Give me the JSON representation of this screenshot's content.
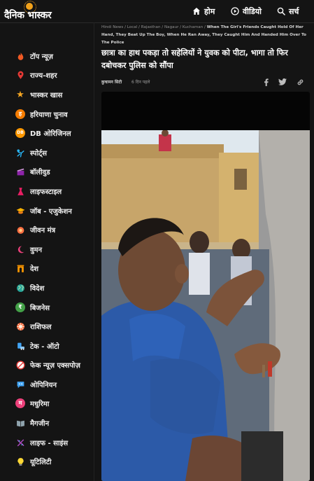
{
  "header": {
    "logo_text": "दैनिक भास्कर",
    "nav": [
      {
        "label": "होम",
        "icon": "home-icon"
      },
      {
        "label": "वीडियो",
        "icon": "play-circle-icon"
      },
      {
        "label": "सर्च",
        "icon": "search-icon"
      }
    ]
  },
  "sidebar": {
    "items": [
      {
        "label": "टॉप न्यूज़",
        "icon": "flame-icon",
        "color": "#f15a24"
      },
      {
        "label": "राज्य-शहर",
        "icon": "location-pin-icon",
        "color": "#e53935"
      },
      {
        "label": "भास्कर खास",
        "icon": "star-icon",
        "color": "#f5a623"
      },
      {
        "label": "हरियाणा चुनाव",
        "icon": "haryana-election-icon",
        "color": "#f57c00"
      },
      {
        "label": "DB ओरिजिनल",
        "icon": "db-original-icon",
        "color": "#ff9800"
      },
      {
        "label": "स्पोर्ट्स",
        "icon": "sports-icon",
        "color": "#29b6f6"
      },
      {
        "label": "बॉलीवुड",
        "icon": "clapperboard-icon",
        "color": "#8e24aa"
      },
      {
        "label": "लाइफस्टाइल",
        "icon": "lifestyle-icon",
        "color": "#e91e63"
      },
      {
        "label": "जॉब - एजुकेशन",
        "icon": "graduation-cap-icon",
        "color": "#ffb300"
      },
      {
        "label": "जीवन मंत्र",
        "icon": "jeevan-mantra-icon",
        "color": "#ff7043"
      },
      {
        "label": "वुमन",
        "icon": "woman-icon",
        "color": "#ec407a"
      },
      {
        "label": "देश",
        "icon": "india-gate-icon",
        "color": "#ff9800"
      },
      {
        "label": "विदेश",
        "icon": "globe-icon",
        "color": "#26a69a"
      },
      {
        "label": "बिजनेस",
        "icon": "rupee-icon",
        "color": "#43a047"
      },
      {
        "label": "राशिफल",
        "icon": "zodiac-wheel-icon",
        "color": "#ff7043"
      },
      {
        "label": "टेक - ऑटो",
        "icon": "tech-auto-icon",
        "color": "#42a5f5"
      },
      {
        "label": "फेक न्यूज़ एक्सपोज़",
        "icon": "fake-news-icon",
        "color": "#e53935"
      },
      {
        "label": "ओपिनियन",
        "icon": "speech-bubble-icon",
        "color": "#42a5f5"
      },
      {
        "label": "मधुरिमा",
        "icon": "madhurima-icon",
        "color": "#ec407a"
      },
      {
        "label": "मैगजीन",
        "icon": "magazine-icon",
        "color": "#90a4ae"
      },
      {
        "label": "लाइफ - साइंस",
        "icon": "dna-icon",
        "color": "#ab47bc"
      },
      {
        "label": "यूटिलिटी",
        "icon": "bulb-icon",
        "color": "#fdd835"
      }
    ]
  },
  "breadcrumb": {
    "items": [
      "Hindi News",
      "Local",
      "Rajasthan",
      "Nagaur",
      "Kuchaman"
    ],
    "current": "When The Girl's Friends Caught Hold Of Her Hand, They Beat Up The Boy, When He Ran Away, They Caught Him And Handed Him Over To The Police"
  },
  "article": {
    "headline": "छात्रा का हाथ पकड़ा तो सहेलियों ने युवक को पीटा, भागा तो फिर दबोचकर पुलिस को सौंपा",
    "author": "कुचामन सिटी",
    "time": "6 दिन पहले",
    "share_icons": [
      "facebook-icon",
      "twitter-icon",
      "link-icon"
    ]
  }
}
